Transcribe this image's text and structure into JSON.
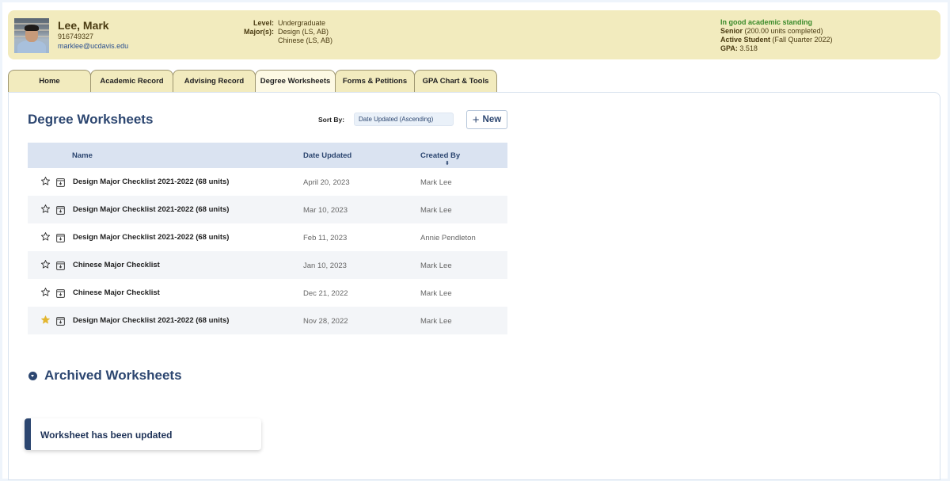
{
  "student": {
    "name": "Lee, Mark",
    "id": "916749327",
    "email": "marklee@ucdavis.edu",
    "level_label": "Level:",
    "level_value": "Undergraduate",
    "majors_label": "Major(s):",
    "majors": [
      "Design (LS, AB)",
      "Chinese (LS, AB)"
    ],
    "standing": "In good academic standing",
    "class_label": "Senior",
    "class_detail": " (200.00 units completed)",
    "active_label": "Active Student",
    "active_detail": " (Fall Quarter 2022)",
    "gpa_label": "GPA:",
    "gpa_value": " 3.518"
  },
  "tabs": [
    {
      "label": "Home",
      "active": false
    },
    {
      "label": "Academic Record",
      "active": false
    },
    {
      "label": "Advising Record",
      "active": false
    },
    {
      "label": "Degree Worksheets",
      "active": true
    },
    {
      "label": "Forms & Petitions",
      "active": false
    },
    {
      "label": "GPA Chart & Tools",
      "active": false
    }
  ],
  "main": {
    "title": "Degree Worksheets",
    "sort_label": "Sort By:",
    "sort_value": "Date Updated (Ascending)",
    "new_button": "New",
    "columns": {
      "name": "Name",
      "date": "Date Updated",
      "created_by": "Created By"
    },
    "rows": [
      {
        "name": "Design Major Checklist 2021-2022 (68 units)",
        "date": "April 20, 2023",
        "created_by": "Mark Lee",
        "starred": false
      },
      {
        "name": "Design Major Checklist 2021-2022 (68 units)",
        "date": "Mar 10, 2023",
        "created_by": "Mark Lee",
        "starred": false
      },
      {
        "name": "Design Major Checklist 2021-2022 (68 units)",
        "date": "Feb 11, 2023",
        "created_by": "Annie Pendleton",
        "starred": false
      },
      {
        "name": "Chinese Major Checklist",
        "date": "Jan 10, 2023",
        "created_by": "Mark Lee",
        "starred": false
      },
      {
        "name": "Chinese Major Checklist",
        "date": "Dec 21, 2022",
        "created_by": "Mark Lee",
        "starred": false
      },
      {
        "name": "Design Major Checklist 2021-2022 (68 units)",
        "date": "Nov 28, 2022",
        "created_by": "Mark Lee",
        "starred": true
      }
    ],
    "archived_title": "Archived Worksheets"
  },
  "toast": {
    "message": "Worksheet has been updated"
  },
  "icons": {
    "star": "star-icon",
    "archive": "archive-icon",
    "sort": "sort-icon",
    "expand": "chevron-down-circle-icon",
    "plus": "plus-icon"
  },
  "colors": {
    "header_bg": "#f2ebbe",
    "accent": "#2c4670",
    "star_filled": "#e3b62f",
    "standing_green": "#3a8a2a"
  }
}
